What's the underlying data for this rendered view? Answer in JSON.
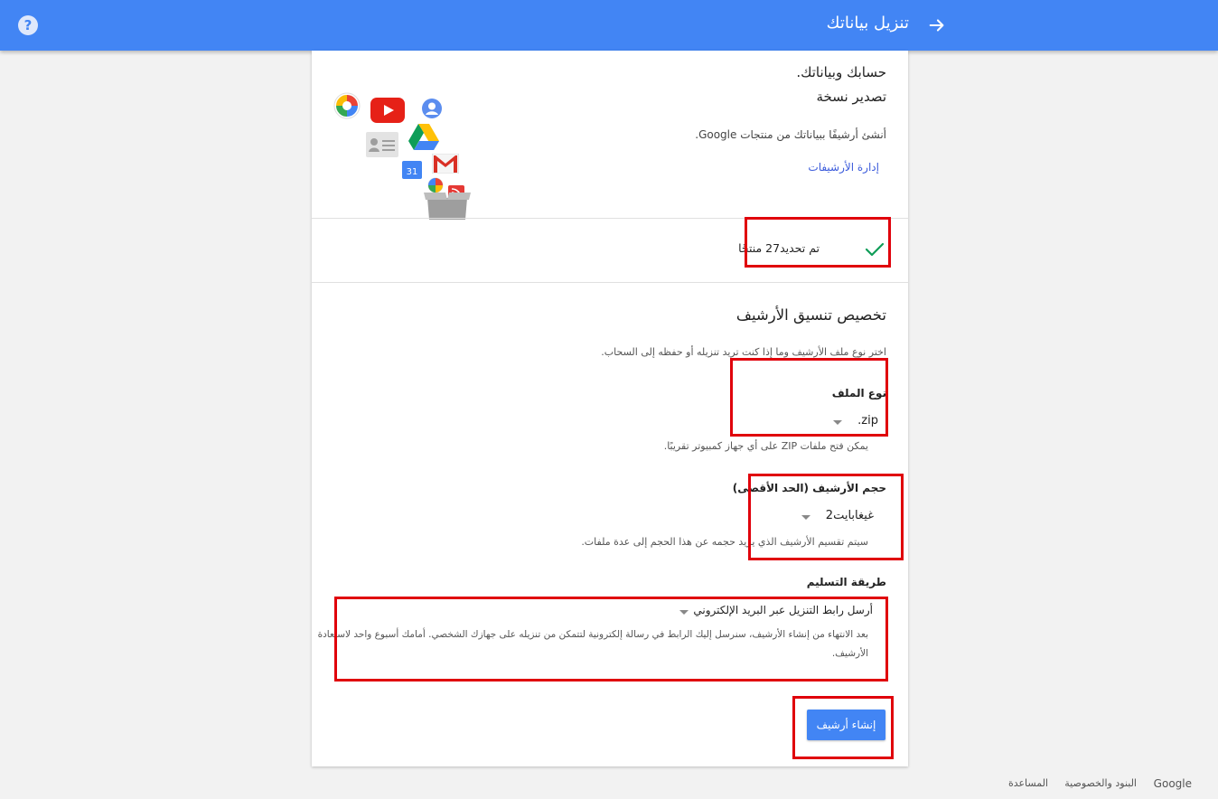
{
  "header": {
    "title": "تنزيل بياناتك",
    "help_symbol": "?",
    "bg_color": "#4285f4",
    "back_icon": "arrow-right-icon",
    "help_icon": "help-circle-icon"
  },
  "intro": {
    "line1": "حسابك وبياناتك.",
    "line2": "تصدير نسخة",
    "description": "أنشئ أرشيفًا ببياناتك من منتجات Google.",
    "manage_link": "إدارة الأرشيفات",
    "calendar_day": "31"
  },
  "products": {
    "selected_text": "تم تحديد27 منتجًا",
    "check_icon": "checkmark-icon"
  },
  "format": {
    "heading": "تخصيص تنسيق الأرشيف",
    "description": "اختر نوع ملف الأرشيف وما إذا كنت تريد تنزيله أو حفظه إلى السحاب.",
    "file_type": {
      "label": "نوع الملف",
      "value": ".zip",
      "hint": "يمكن فتح ملفات ZIP على أي جهاز كمبيوتر تقريبًا."
    },
    "archive_size": {
      "label": "حجم الأرشيف (الحد الأقصى)",
      "value": "2غيغابايت",
      "hint": "سيتم تقسيم الأرشيف الذي يزيد حجمه عن هذا الحجم إلى عدة ملفات."
    },
    "delivery": {
      "label": "طريقة التسليم",
      "value": "أرسل رابط التنزيل عبر البريد الإلكتروني",
      "hint_line1": "بعد الانتهاء من إنشاء الأرشيف، سنرسل إليك الرابط في رسالة إلكترونية لتتمكن من تنزيله على جهازك الشخصي. أمامك أسبوع واحد لاستعادة",
      "hint_line2": "الأرشيف."
    },
    "create_button": "إنشاء أرشيف"
  },
  "footer": {
    "brand": "Google",
    "terms": "البنود والخصوصية",
    "help": "المساعدة"
  },
  "colors": {
    "accent": "#4285f4",
    "highlight_box": "#e0000b",
    "check": "#0f9d58",
    "link": "#3b5bdb"
  }
}
